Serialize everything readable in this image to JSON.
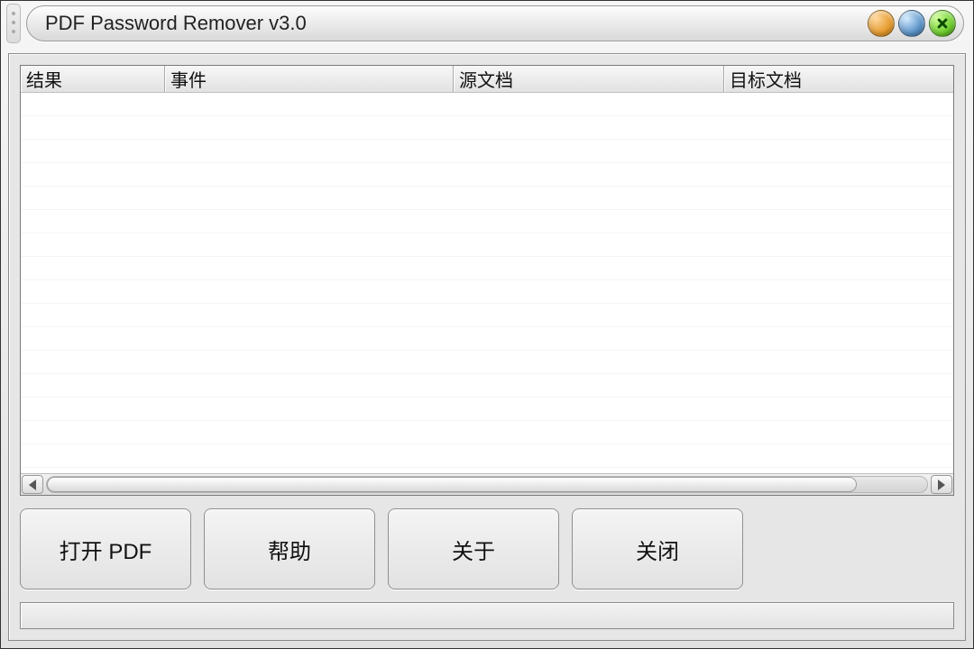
{
  "window": {
    "title": "PDF Password Remover v3.0"
  },
  "list": {
    "columns": [
      "结果",
      "事件",
      "源文档",
      "目标文档"
    ],
    "rows": []
  },
  "buttons": {
    "open_pdf": "打开 PDF",
    "help": "帮助",
    "about": "关于",
    "close": "关闭"
  },
  "status": ""
}
